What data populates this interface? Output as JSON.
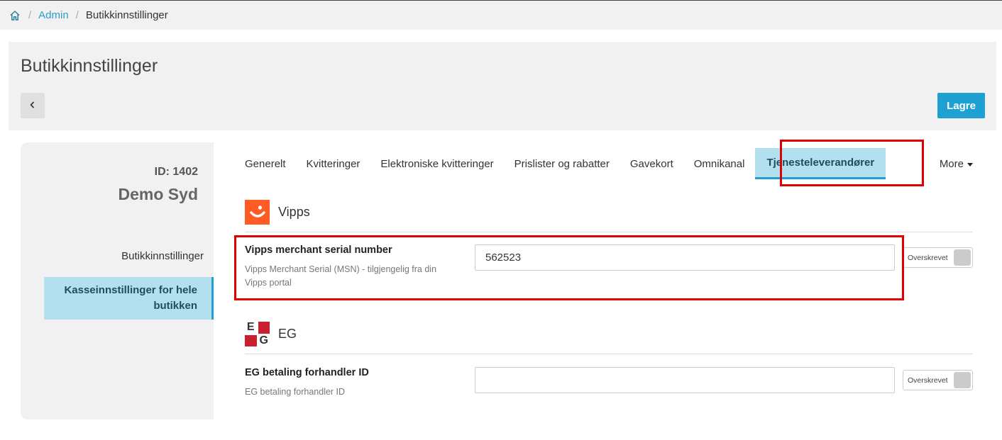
{
  "breadcrumb": {
    "home_icon": "home-icon",
    "separator": "/",
    "admin": "Admin",
    "current": "Butikkinnstillinger"
  },
  "header": {
    "title": "Butikkinnstillinger",
    "back_icon": "chevron-left-icon",
    "save_label": "Lagre",
    "accent_color": "#1ea1d2"
  },
  "store": {
    "id_label": "ID: 1402",
    "name": "Demo Syd"
  },
  "side_nav": {
    "items": [
      {
        "label": "Butikkinnstillinger",
        "active": false
      },
      {
        "label": "Kasseinnstillinger for hele butikken",
        "active": true
      }
    ]
  },
  "tabs": {
    "items": [
      {
        "label": "Generelt"
      },
      {
        "label": "Kvitteringer"
      },
      {
        "label": "Elektroniske kvitteringer"
      },
      {
        "label": "Prislister og rabatter"
      },
      {
        "label": "Gavekort"
      },
      {
        "label": "Omnikanal"
      },
      {
        "label": "Tjenesteleverandører",
        "active": true
      }
    ],
    "more_label": "More",
    "more_icon": "caret-down-icon"
  },
  "vipps": {
    "title": "Vipps",
    "logo_color": "#ff5b24",
    "field": {
      "label": "Vipps merchant serial number",
      "help": "Vipps Merchant Serial (MSN) - tilgjengelig fra din Vipps portal",
      "value": "562523",
      "override_label": "Overskrevet"
    }
  },
  "eg": {
    "title": "EG",
    "logo_letters": [
      "E",
      "G"
    ],
    "logo_color": "#c8202f",
    "field": {
      "label": "EG betaling forhandler ID",
      "help": "EG betaling forhandler ID",
      "value": "",
      "override_label": "Overskrevet"
    }
  },
  "annotation_color": "#e00000"
}
